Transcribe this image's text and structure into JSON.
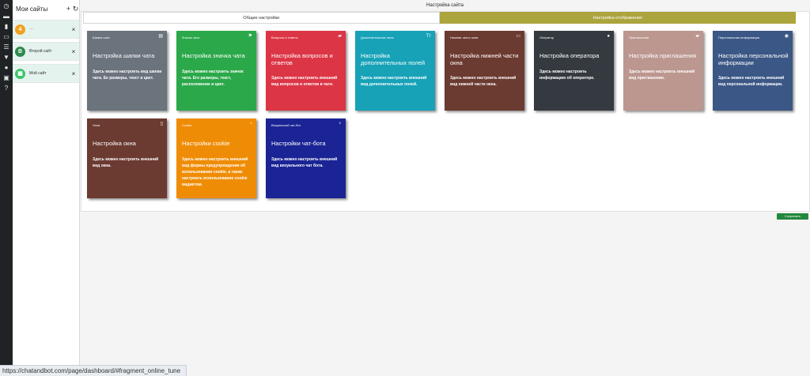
{
  "rail": {
    "icons": [
      "dashboard-icon",
      "folder-icon",
      "chat-icon",
      "image-icon",
      "users-icon",
      "plugin-icon",
      "user-circle-icon",
      "window-icon",
      "help-icon"
    ],
    "glyphs": [
      "◷",
      "▬",
      "▮",
      "▭",
      "☰",
      "▼",
      "●",
      "▣",
      "?"
    ]
  },
  "sites_panel": {
    "title": "Мои сайты",
    "add_glyph": "+",
    "refresh_glyph": "↻",
    "close_glyph": "×",
    "sites": [
      {
        "avatar": "4",
        "name": "···",
        "color": "#f0a11f"
      },
      {
        "avatar": "B",
        "name": "Второй сайт",
        "color": "#2e8b4d"
      },
      {
        "avatar": "▦",
        "name": "Мой сайт",
        "color": "#3cc46a"
      }
    ]
  },
  "page": {
    "title": "Настройка сайта",
    "tabs": [
      "Общие настройки",
      "Настройка отображения"
    ],
    "active_tab": 1,
    "save_label": "Сохранить"
  },
  "cards": [
    {
      "header": "Шапка чата",
      "title": "Настройка шапки чата",
      "desc": "Здесь можно настроить вид шапки чата. Ее размеры, текст и цвет.",
      "color": "#6b737d",
      "icon": "document-icon",
      "glyph": "▤",
      "dtop": 48
    },
    {
      "header": "Значок чата",
      "title": "Настройка значка чата",
      "desc": "Здесь можно настроить значок чата. Его размеры, текст, расположение и цвет.",
      "color": "#2ba84a",
      "icon": "flag-icon",
      "glyph": "⚑",
      "dtop": 48
    },
    {
      "header": "Вопросы и ответы",
      "title": "Настройка вопросов и ответов",
      "desc": "Здесь можно настроить внешний вид вопросов и ответов в чате.",
      "color": "#dc3545",
      "icon": "comment-icon",
      "glyph": "▰",
      "dtop": 56
    },
    {
      "header": "Дополнительные поля",
      "title": "Настройка дополнительных полей",
      "desc": "Здесь можно настроить внешний вид дополнительных полей.",
      "color": "#17a2b8",
      "icon": "text-size-icon",
      "glyph": "Tт",
      "dtop": 56
    },
    {
      "header": "Нижняя часть окна",
      "title": "Настройка нижней части окна",
      "desc": "Здесь можно настроить внешний вид нижней части окна.",
      "color": "#6b3a31",
      "icon": "book-icon",
      "glyph": "▭",
      "dtop": 56
    },
    {
      "header": "Оператор",
      "title": "Настройка оператора",
      "desc": "Здесь можно настроить информацию об операторе.",
      "color": "#343a40",
      "icon": "user-icon",
      "glyph": "●",
      "dtop": 48
    },
    {
      "header": "Приглашение",
      "title": "Настройка приглашения",
      "desc": "Здесь можно настроить внешний вид приглашения.",
      "color": "#bc978f",
      "icon": "comment-icon",
      "glyph": "▰",
      "dtop": 48
    },
    {
      "header": "Персональная информация",
      "title": "Настройка персональной информации",
      "desc": "Здесь можно настроить внешний вид персональной информации.",
      "color": "#3b5785",
      "icon": "globe-icon",
      "glyph": "◉",
      "dtop": 56
    },
    {
      "header": "Окна",
      "title": "Настройка окна",
      "desc": "Здесь можно настроить внешний вид окна.",
      "color": "#6b3a31",
      "icon": "mobile-icon",
      "glyph": "▯",
      "dtop": 48
    },
    {
      "header": "Cookie",
      "title": "Настройки cookie",
      "desc": "Здесь можно настроить внешний вид формы предупреждения об использовании cookie, а также настроить использование cookie виджетом.",
      "color": "#ef8c06",
      "icon": "cookie-icon",
      "glyph": "◔",
      "dtop": 48
    },
    {
      "header": "Визуальный чат-бот",
      "title": "Настройки чат-бота",
      "desc": "Здесь можно настроить внешний вид визуального чат бота.",
      "color": "#1a2494",
      "icon": "plug-icon",
      "glyph": "♆",
      "dtop": 48
    }
  ],
  "status_bar": "https://chatandbot.com/page/dashboard/#fragment_online_tune"
}
